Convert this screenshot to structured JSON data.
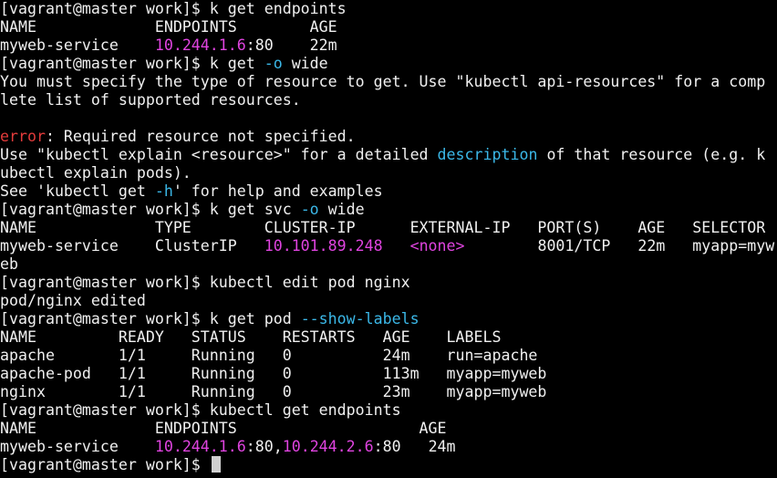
{
  "colors": {
    "background": "#000000",
    "text": "#f0f0f0",
    "ip": "#e044e0",
    "flag": "#3bb8e8",
    "error": "#e23b3b",
    "cursor": "#d0d0d0"
  },
  "lines": [
    [
      {
        "t": "[vagrant@master work]$ k get endpoints"
      }
    ],
    [
      {
        "t": "NAME             ENDPOINTS        AGE"
      }
    ],
    [
      {
        "t": "myweb-service    "
      },
      {
        "t": "10.244.1.6",
        "c": "ip"
      },
      {
        "t": ":80    22m"
      }
    ],
    [
      {
        "t": "[vagrant@master work]$ k get "
      },
      {
        "t": "-o",
        "c": "flag"
      },
      {
        "t": " wide"
      }
    ],
    [
      {
        "t": "You must specify the type of resource to get. Use \"kubectl api-resources\" for a comp"
      }
    ],
    [
      {
        "t": "lete list of supported resources."
      }
    ],
    [
      {
        "t": ""
      }
    ],
    [
      {
        "t": "error",
        "c": "error"
      },
      {
        "t": ": Required resource not specified."
      }
    ],
    [
      {
        "t": "Use \"kubectl explain <resource>\" for a detailed "
      },
      {
        "t": "description",
        "c": "flag"
      },
      {
        "t": " of that resource (e.g. k"
      }
    ],
    [
      {
        "t": "ubectl explain pods)."
      }
    ],
    [
      {
        "t": "See 'kubectl get "
      },
      {
        "t": "-h",
        "c": "flag"
      },
      {
        "t": "' for help and examples"
      }
    ],
    [
      {
        "t": "[vagrant@master work]$ k get svc "
      },
      {
        "t": "-o",
        "c": "flag"
      },
      {
        "t": " wide"
      }
    ],
    [
      {
        "t": "NAME             TYPE        CLUSTER-IP      EXTERNAL-IP   PORT(S)    AGE   SELECTOR"
      }
    ],
    [
      {
        "t": "myweb-service    ClusterIP   "
      },
      {
        "t": "10.101.89.248",
        "c": "ip"
      },
      {
        "t": "   "
      },
      {
        "t": "<none>",
        "c": "ip"
      },
      {
        "t": "        8001/TCP   22m   myapp=myw"
      }
    ],
    [
      {
        "t": "eb"
      }
    ],
    [
      {
        "t": "[vagrant@master work]$ kubectl edit pod nginx"
      }
    ],
    [
      {
        "t": "pod/nginx edited"
      }
    ],
    [
      {
        "t": "[vagrant@master work]$ k get pod "
      },
      {
        "t": "--show-labels",
        "c": "flag"
      }
    ],
    [
      {
        "t": "NAME         READY   STATUS    RESTARTS   AGE    LABELS"
      }
    ],
    [
      {
        "t": "apache       1/1     Running   0          24m    run=apache"
      }
    ],
    [
      {
        "t": "apache-pod   1/1     Running   0          113m   myapp=myweb"
      }
    ],
    [
      {
        "t": "nginx        1/1     Running   0          23m    myapp=myweb"
      }
    ],
    [
      {
        "t": "[vagrant@master work]$ kubectl get endpoints"
      }
    ],
    [
      {
        "t": "NAME             ENDPOINTS                    AGE"
      }
    ],
    [
      {
        "t": "myweb-service    "
      },
      {
        "t": "10.244.1.6",
        "c": "ip"
      },
      {
        "t": ":80,"
      },
      {
        "t": "10.244.2.6",
        "c": "ip"
      },
      {
        "t": ":80   24m"
      }
    ],
    [
      {
        "t": "[vagrant@master work]$ "
      }
    ]
  ]
}
